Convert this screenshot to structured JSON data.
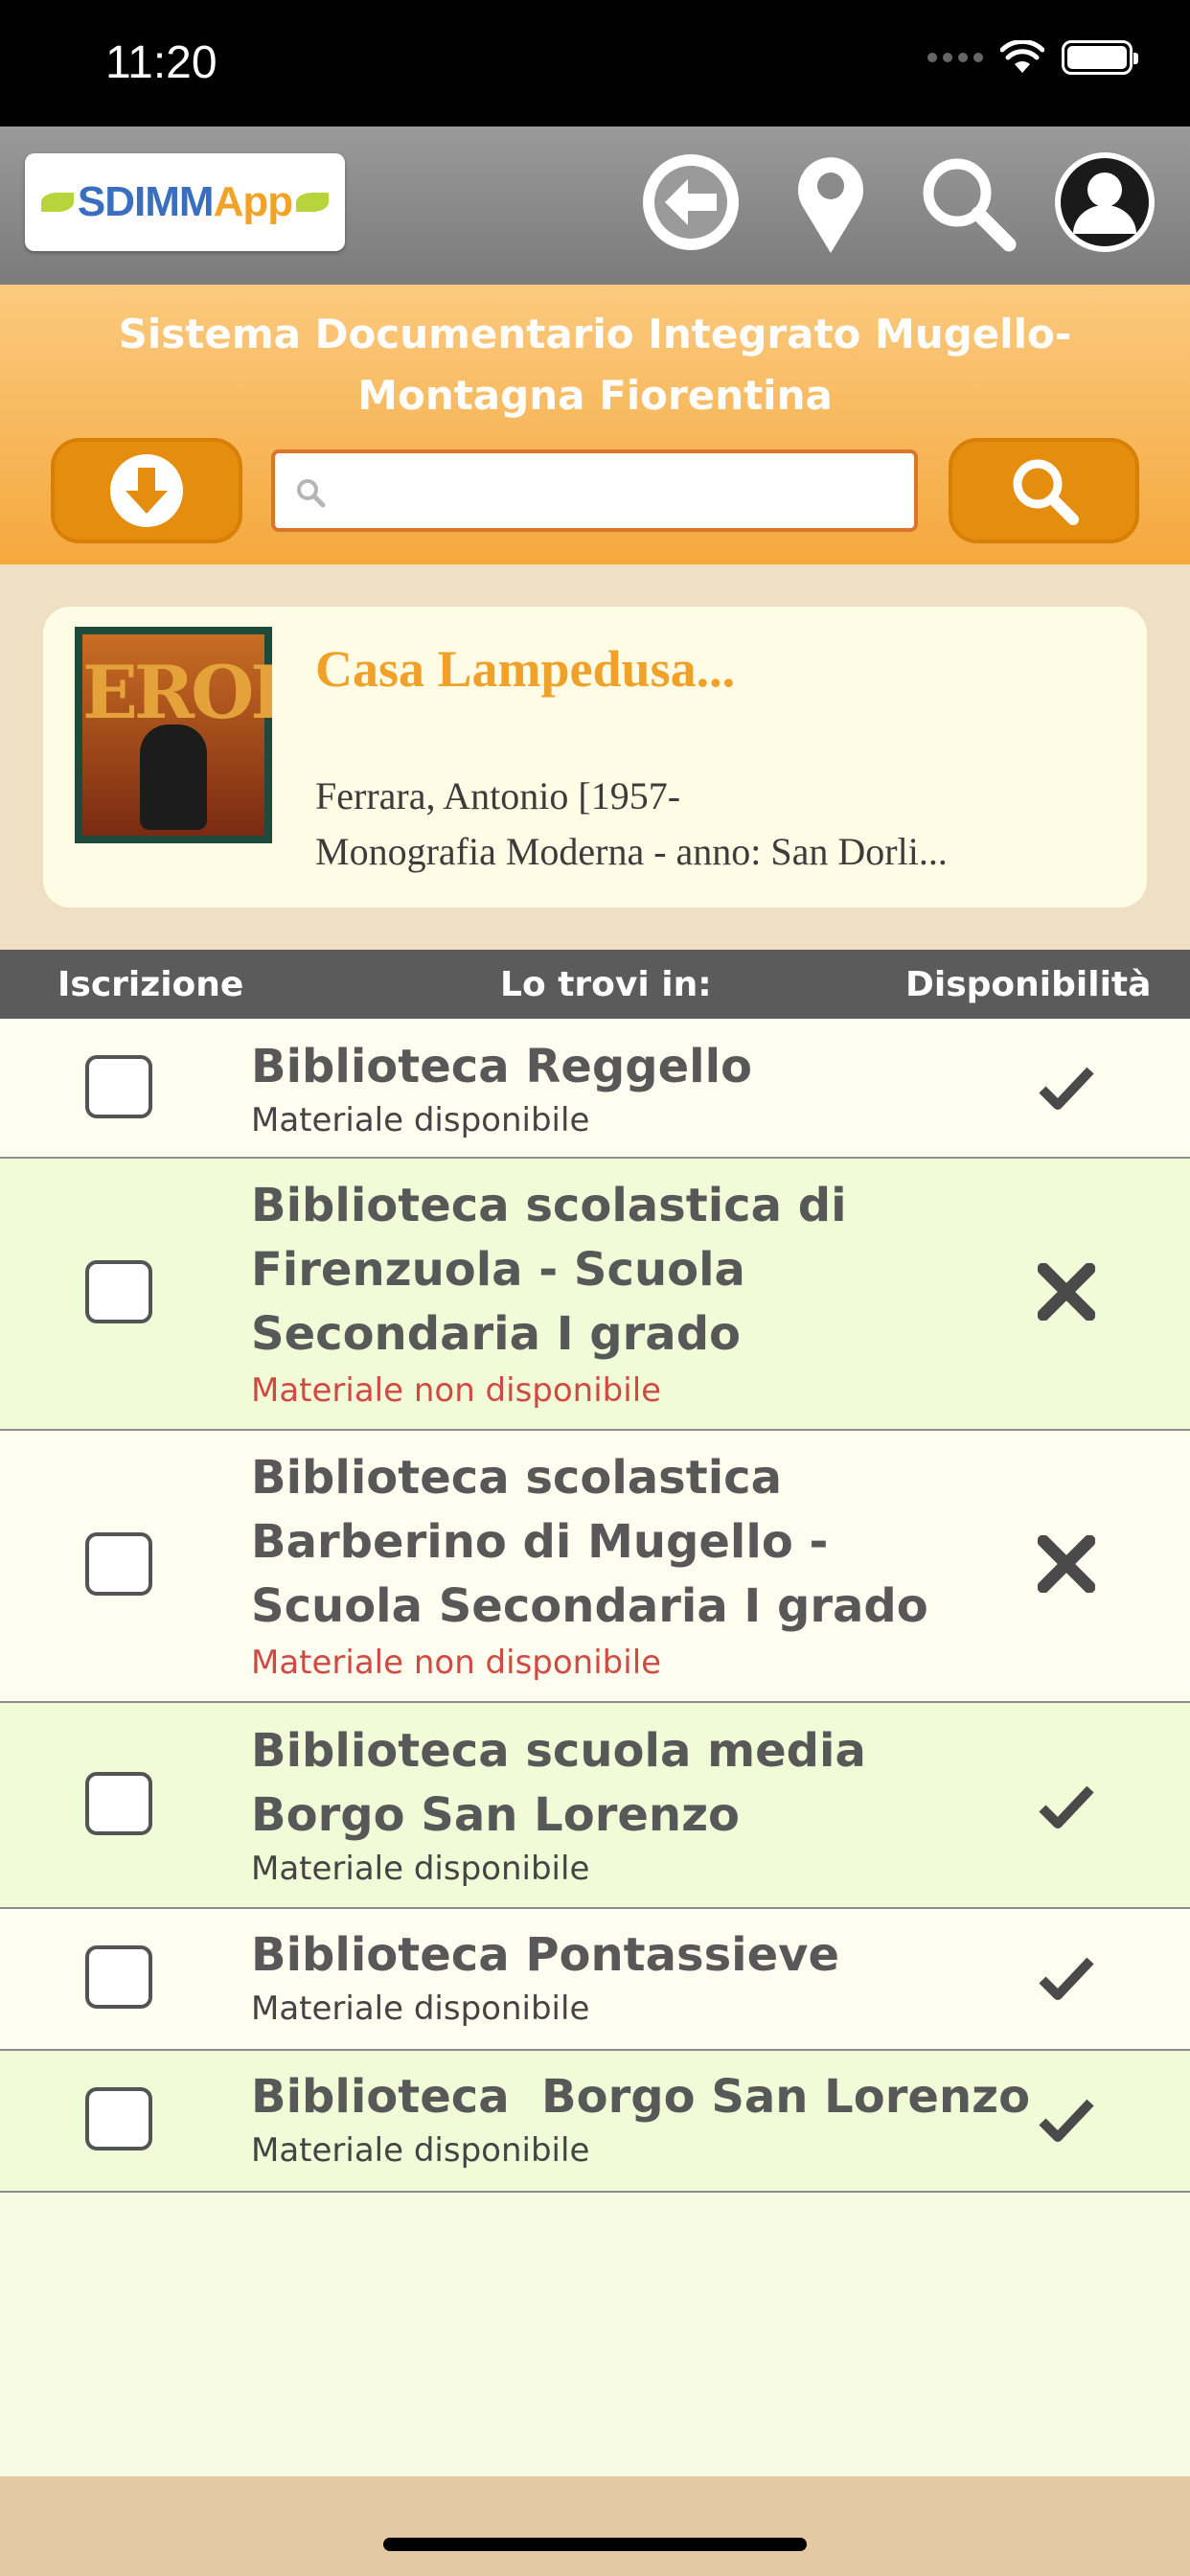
{
  "status_bar": {
    "time": "11:20"
  },
  "toolbar": {
    "logo": {
      "part1": "SDIMM",
      "part2": "App"
    },
    "icons": [
      "back-arrow-icon",
      "location-pin-icon",
      "search-icon",
      "user-profile-icon"
    ]
  },
  "header": {
    "title": "Sistema Documentario Integrato Mugello-Montagna Fiorentina",
    "search_value": "",
    "search_placeholder": ""
  },
  "book": {
    "title": "Casa Lampedusa...",
    "author": "Ferrara, Antonio [1957-",
    "type": "Monografia Moderna - anno: San Dorli...",
    "cover": {
      "title": "EROI"
    }
  },
  "table": {
    "headers": {
      "subscription": "Iscrizione",
      "location": "Lo trovi in:",
      "availability": "Disponibilità"
    },
    "rows": [
      {
        "name": "Biblioteca Reggello",
        "status": "Materiale disponibile",
        "available": true
      },
      {
        "name": "Biblioteca scolastica di Firenzuola - Scuola Secondaria I grado",
        "status": "Materiale non disponibile",
        "available": false
      },
      {
        "name": "Biblioteca scolastica Barberino di Mugello - Scuola Secondaria I grado",
        "status": "Materiale non disponibile",
        "available": false
      },
      {
        "name": "Biblioteca scuola media Borgo San Lorenzo",
        "status": "Materiale disponibile",
        "available": true
      },
      {
        "name": "Biblioteca Pontassieve",
        "status": "Materiale disponibile",
        "available": true
      },
      {
        "name": "Biblioteca  Borgo San Lorenzo",
        "status": "Materiale disponibile",
        "available": true
      }
    ]
  },
  "colors": {
    "accent_orange": "#f5a83d",
    "button_orange": "#e48d0e",
    "unavailable_red": "#cf4a42",
    "header_gray": "#5b5b5b"
  }
}
